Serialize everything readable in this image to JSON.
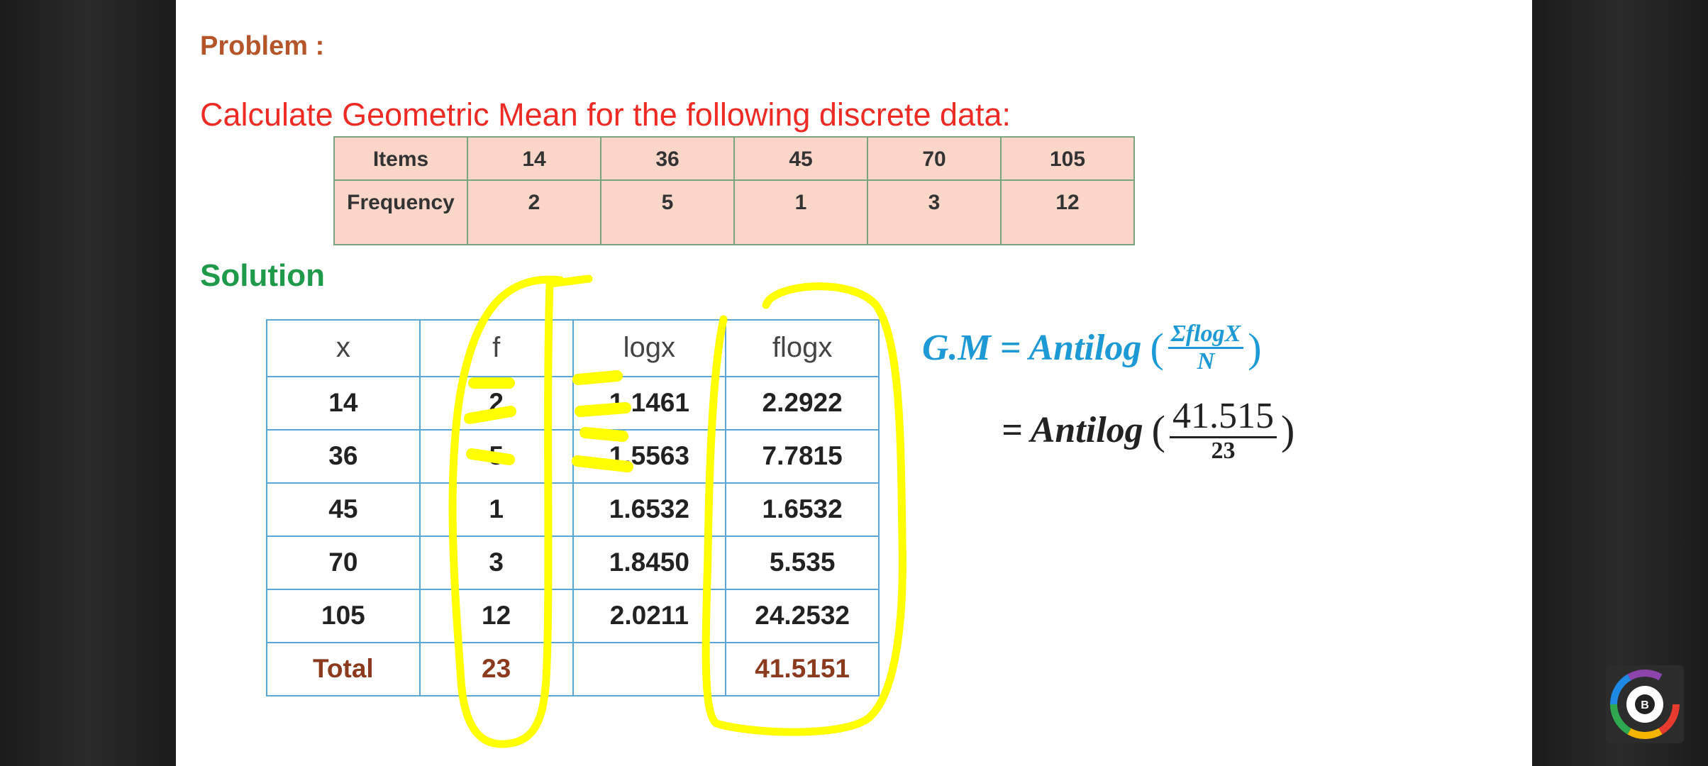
{
  "problem_label": "Problem :",
  "question": "Calculate Geometric Mean for the following discrete data:",
  "given_table": {
    "row1": [
      "Items",
      "14",
      "36",
      "45",
      "70",
      "105"
    ],
    "row2": [
      "Frequency",
      "2",
      "5",
      "1",
      "3",
      "12"
    ]
  },
  "solution_label": "Solution",
  "solution_table": {
    "headers": [
      "x",
      "f",
      "logx",
      "flogx"
    ],
    "rows": [
      [
        "14",
        "2",
        "1.1461",
        "2.2922"
      ],
      [
        "36",
        "5",
        "1.5563",
        "7.7815"
      ],
      [
        "45",
        "1",
        "1.6532",
        "1.6532"
      ],
      [
        "70",
        "3",
        "1.8450",
        "5.535"
      ],
      [
        "105",
        "12",
        "2.0211",
        "24.2532"
      ]
    ],
    "total": [
      "Total",
      "23",
      "",
      "41.5151"
    ]
  },
  "formula": {
    "line1_prefix": "G.M = Antilog",
    "line1_num": "ΣflogX",
    "line1_den": "N",
    "line2_prefix": "= Antilog",
    "line2_num": "41.515",
    "line2_den": "23",
    "open_paren": "(",
    "close_paren": ")"
  },
  "colors": {
    "problem": "#b5562a",
    "question": "#ee2a24",
    "solution": "#1f9a4a",
    "formula_blue": "#1d9ad6",
    "total_text": "#8b3a1e",
    "highlight": "#ffff00",
    "given_fill": "#f9d6c7"
  },
  "icons": {
    "channel_logo": "colorful-b-logo-icon"
  }
}
